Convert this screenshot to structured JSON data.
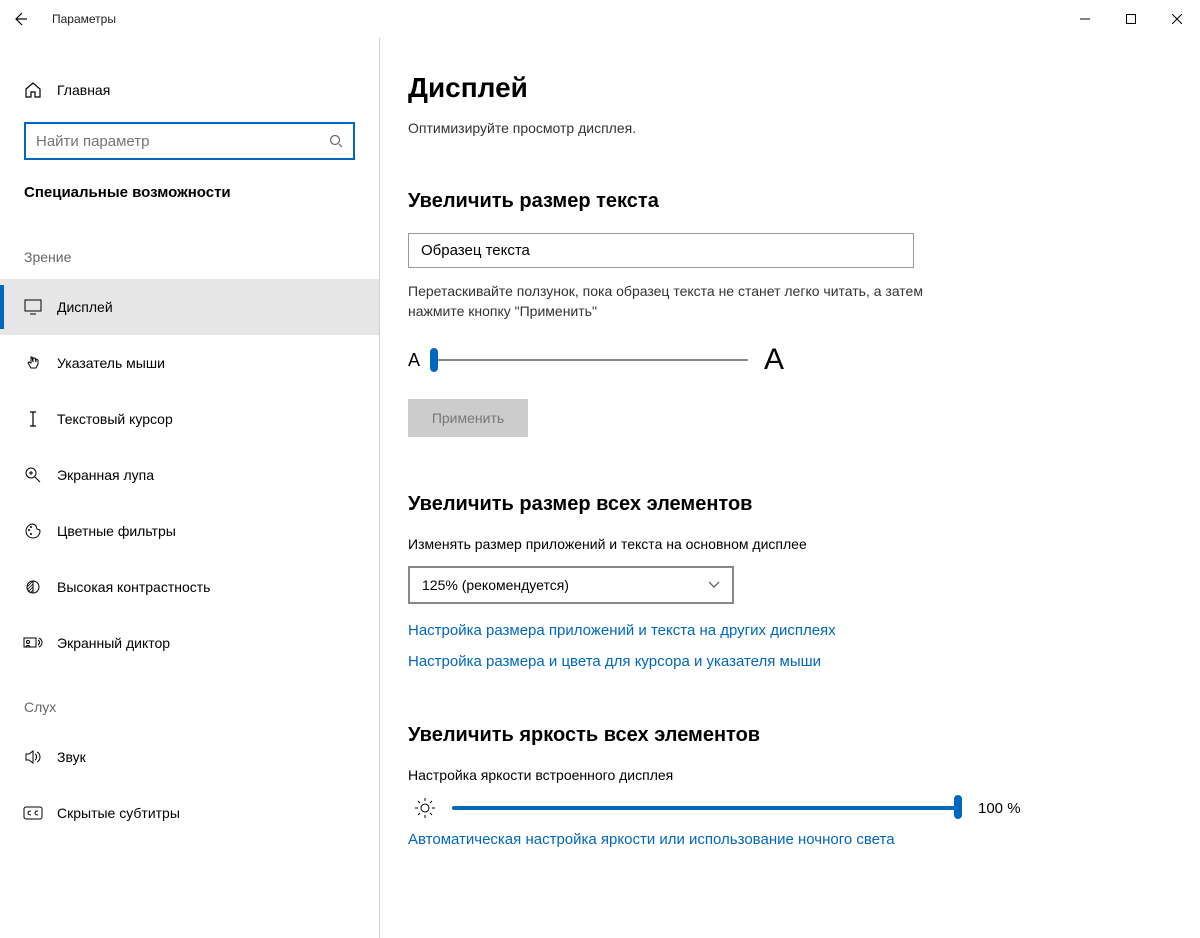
{
  "titlebar": {
    "title": "Параметры"
  },
  "sidebar": {
    "home": "Главная",
    "search_placeholder": "Найти параметр",
    "category": "Специальные возможности",
    "groups": [
      {
        "label": "Зрение",
        "items": [
          {
            "name": "display",
            "label": "Дисплей",
            "active": true,
            "icon": "monitor"
          },
          {
            "name": "pointer",
            "label": "Указатель мыши",
            "icon": "cursor-hand"
          },
          {
            "name": "textcursor",
            "label": "Текстовый курсор",
            "icon": "text-cursor"
          },
          {
            "name": "magnifier",
            "label": "Экранная лупа",
            "icon": "magnifier-plus"
          },
          {
            "name": "colorfilters",
            "label": "Цветные фильтры",
            "icon": "palette"
          },
          {
            "name": "highcontrast",
            "label": "Высокая контрастность",
            "icon": "contrast"
          },
          {
            "name": "narrator",
            "label": "Экранный диктор",
            "icon": "narrator"
          }
        ]
      },
      {
        "label": "Слух",
        "items": [
          {
            "name": "sound",
            "label": "Звук",
            "icon": "speaker"
          },
          {
            "name": "cc",
            "label": "Скрытые субтитры",
            "icon": "cc"
          }
        ]
      }
    ]
  },
  "main": {
    "title": "Дисплей",
    "subtitle": "Оптимизируйте просмотр дисплея.",
    "text_size": {
      "heading": "Увеличить размер текста",
      "sample": "Образец текста",
      "help": "Перетаскивайте ползунок, пока образец текста не станет легко читать, а затем нажмите кнопку \"Применить\"",
      "small": "A",
      "large": "A",
      "apply": "Применить"
    },
    "all_size": {
      "heading": "Увеличить размер всех элементов",
      "label": "Изменять размер приложений и текста на основном дисплее",
      "selected": "125% (рекомендуется)",
      "link1": "Настройка размера приложений и текста на других дисплеях",
      "link2": "Настройка размера и цвета для курсора и указателя мыши"
    },
    "brightness": {
      "heading": "Увеличить яркость всех элементов",
      "label": "Настройка яркости встроенного дисплея",
      "value": "100 %",
      "link": "Автоматическая настройка яркости или использование ночного света"
    }
  }
}
